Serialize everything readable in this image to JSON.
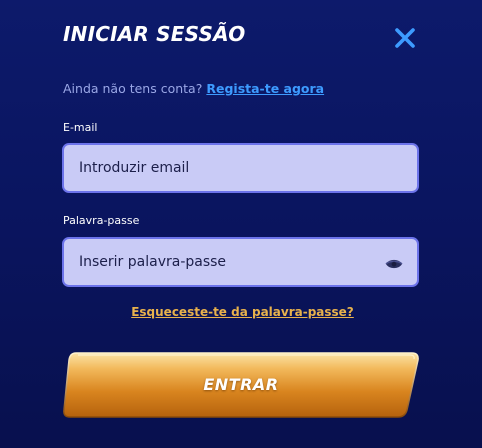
{
  "login_modal": {
    "title": "INICIAR SESSÃO",
    "close_icon": "close-icon",
    "signup_prompt": "Ainda não tens conta?",
    "signup_link": "Regista-te agora",
    "email": {
      "label": "E-mail",
      "placeholder": "Introduzir email",
      "value": ""
    },
    "password": {
      "label": "Palavra-passe",
      "placeholder": "Inserir palavra-passe",
      "value": "",
      "toggle_icon": "eye-icon"
    },
    "forgot_password": "Esqueceste-te da palavra-passe?",
    "submit_label": "ENTRAR"
  },
  "colors": {
    "background": "#0a1560",
    "accent_link": "#3d9bff",
    "input_bg": "#c9cbf6",
    "input_border": "#6c73ea",
    "gold": "#e8b24c",
    "close": "#3d9bff"
  }
}
